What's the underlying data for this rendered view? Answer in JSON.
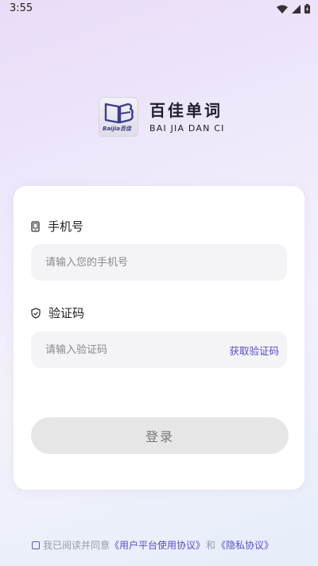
{
  "status_bar": {
    "time": "3:55"
  },
  "brand": {
    "logo_small_text": "Baijia百佳",
    "name_cn": "百佳单词",
    "name_en": "BAI JIA DAN CI"
  },
  "form": {
    "phone": {
      "label": "手机号",
      "placeholder": "请输入您的手机号",
      "value": ""
    },
    "code": {
      "label": "验证码",
      "placeholder": "请输入验证码",
      "value": "",
      "get_code_label": "获取验证码"
    },
    "login_label": "登录"
  },
  "agreement": {
    "prefix": "我已阅读并同意",
    "user_agreement": "《用户平台使用协议》",
    "and": "和",
    "privacy_agreement": "《隐私协议》"
  },
  "colors": {
    "accent": "#5450c9",
    "button_bg": "#e6e6e7"
  }
}
